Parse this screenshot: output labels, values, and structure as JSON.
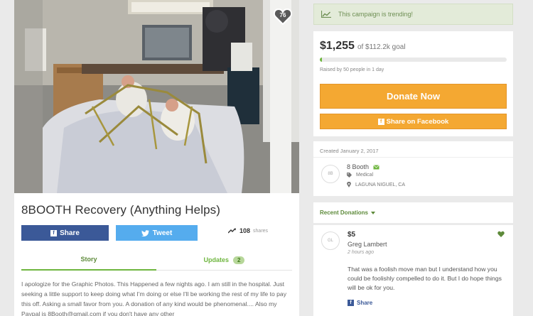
{
  "campaign": {
    "title": "8BOOTH Recovery (Anything Helps)",
    "heart_count": "76",
    "share_label": "Share",
    "tweet_label": "Tweet",
    "share_count": "108",
    "shares_label": "shares",
    "tabs": [
      {
        "label": "Story"
      },
      {
        "label": "Updates",
        "badge": "2"
      }
    ],
    "story": "I apologize for the Graphic Photos. This Happened a few nights ago. I am still in the hospital. Just seeking a little support to keep doing what I'm doing or else I'll be working the rest of my life to pay this off. Asking a small favor from you. A donation of any kind would be phenomenal.... Also my Paypal is 8Booth@gmail.com if you don't have any other"
  },
  "sidebar": {
    "trending": "This campaign is trending!",
    "raised": "$1,255",
    "goal": "of $112.2k goal",
    "progress": 0.011,
    "raised_by": "Raised by 50 people in 1 day",
    "donate_label": "Donate Now",
    "fb_share_label": "Share on Facebook",
    "created": "Created January 2, 2017",
    "organizer": {
      "avatar": "8B",
      "name": "8 Booth",
      "category": "Medical",
      "location": "LAGUNA NIGUEL, CA"
    },
    "recent_donations_label": "Recent Donations",
    "donation": {
      "avatar": "GL",
      "amount": "$5",
      "name": "Greg Lambert",
      "time": "2 hours ago",
      "message": "That was a foolish move man but I understand how you could be foolishly compelled to do it. But I do hope things will be ok for you.",
      "share_label": "Share"
    }
  },
  "colors": {
    "accent_green": "#6fb63f",
    "donate_orange": "#f4a832",
    "facebook_blue": "#3b5998",
    "twitter_blue": "#55acee"
  }
}
